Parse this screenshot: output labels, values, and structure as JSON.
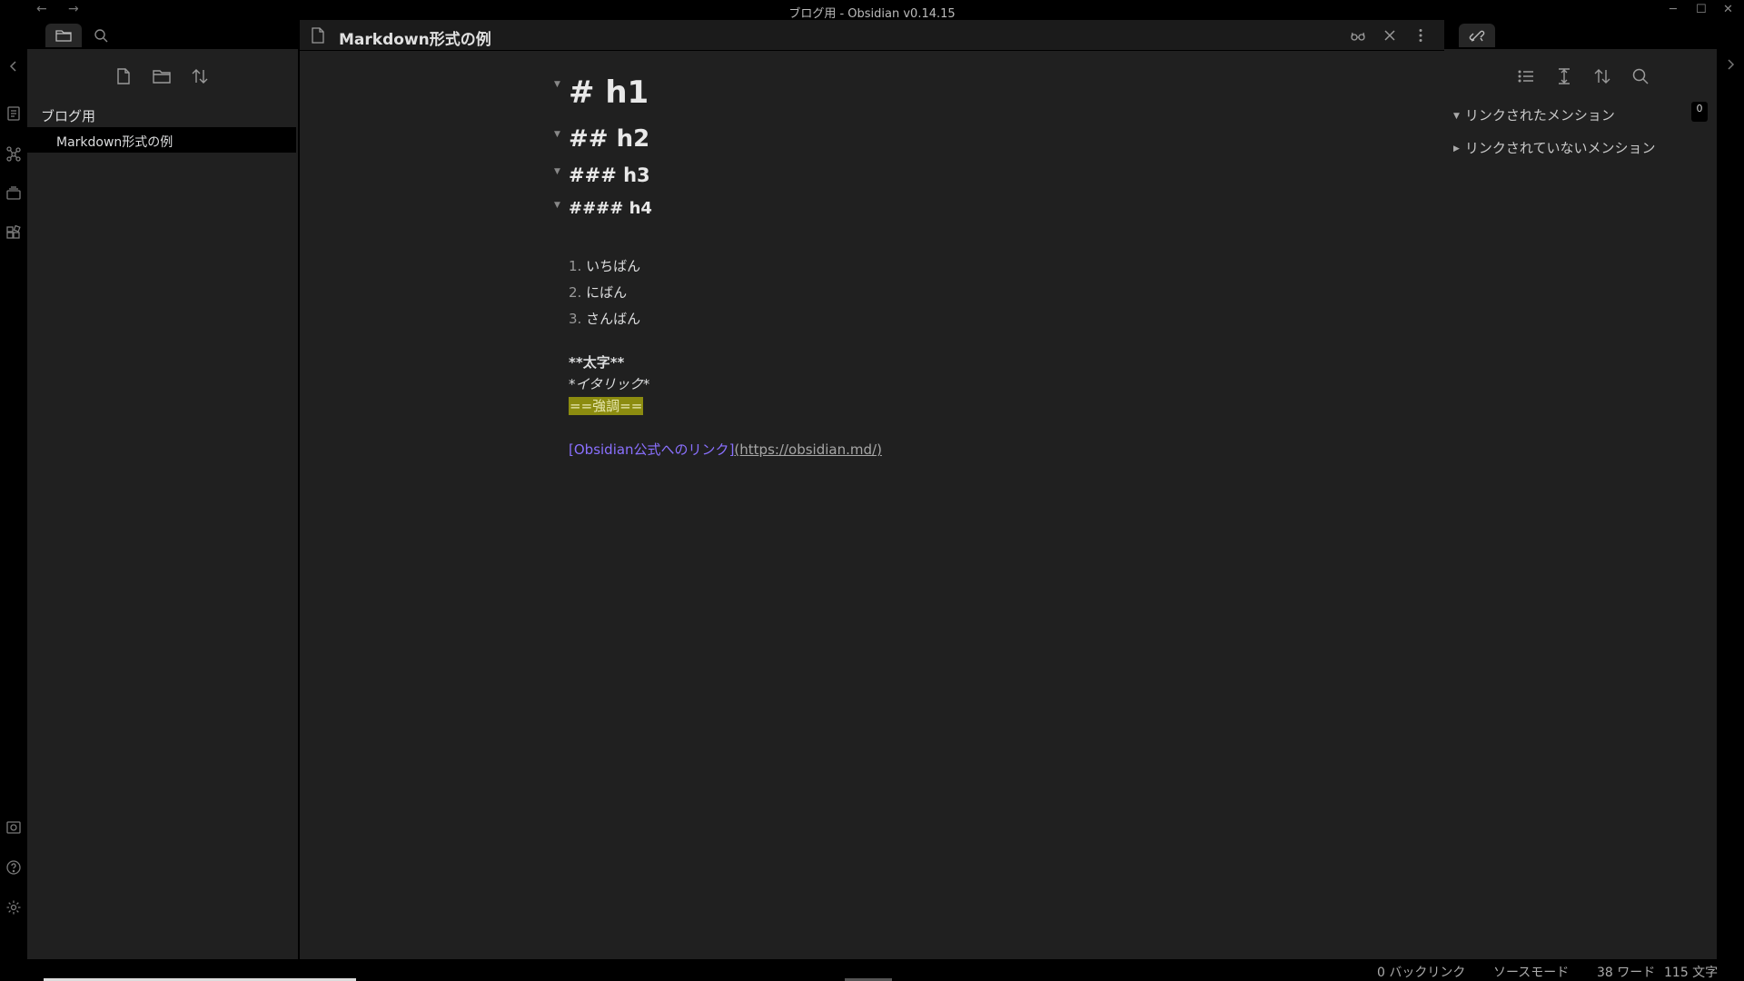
{
  "window": {
    "title": "ブログ用 - Obsidian v0.14.15",
    "back_glyph": "←",
    "forward_glyph": "→",
    "minimize_glyph": "─",
    "maximize_glyph": "☐",
    "close_glyph": "✕"
  },
  "ribbon": {
    "icons": [
      "open-quick-switcher-icon",
      "graph-view-icon",
      "slides-icon",
      "plugins-icon",
      "vault-icon",
      "help-icon",
      "settings-icon"
    ]
  },
  "left_panel": {
    "tabs": [
      "file-explorer-icon",
      "search-icon"
    ],
    "actions": [
      "new-note-icon",
      "new-folder-icon",
      "sort-icon"
    ],
    "vault_name": "ブログ用",
    "files": [
      {
        "name": "Markdown形式の例",
        "active": true
      }
    ]
  },
  "editor": {
    "title": "Markdown形式の例",
    "headings": [
      {
        "level": 1,
        "text": "# h1"
      },
      {
        "level": 2,
        "text": "## h2"
      },
      {
        "level": 3,
        "text": "### h3"
      },
      {
        "level": 4,
        "text": "#### h4"
      }
    ],
    "list": [
      {
        "num": "1.",
        "text": "いちばん"
      },
      {
        "num": "2.",
        "text": "にばん"
      },
      {
        "num": "3.",
        "text": "さんばん"
      }
    ],
    "bold": "**太字**",
    "italic": "*イタリック*",
    "highlight": "==強調==",
    "link": {
      "open_bracket": "[",
      "text": "Obsidian公式へのリンク",
      "close_bracket": "]",
      "url": "(https://obsidian.md/)"
    },
    "fold_glyph": "▼"
  },
  "right_panel": {
    "tab_icon": "backlinks-icon",
    "actions": [
      "list-icon",
      "collapse-icon",
      "sort-icon",
      "search-icon"
    ],
    "linked_mentions": "リンクされたメンション",
    "linked_count": "0",
    "unlinked_mentions": "リンクされていないメンション",
    "caret_open": "▼",
    "caret_closed": "▶"
  },
  "status_bar": {
    "backlinks": "0 バックリンク",
    "mode": "ソースモード",
    "words": "38 ワード",
    "chars": "115 文字"
  },
  "colors": {
    "background": "#202020",
    "chrome": "#000000",
    "accent_link": "#8a70ff",
    "highlight": "#8c8c10"
  }
}
